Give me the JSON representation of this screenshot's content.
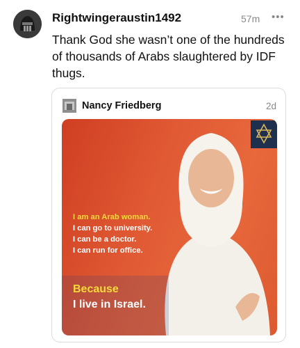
{
  "post": {
    "username": "Rightwingeraustin1492",
    "time": "57m",
    "more": "•••",
    "text": "Thank God she wasn’t one of the hundreds of thousands of Arabs slaughtered by IDF thugs."
  },
  "quote": {
    "name": "Nancy Friedberg",
    "time": "2d",
    "image": {
      "line1": "I am an Arab woman.",
      "line2": "I can go to university.",
      "line3": "I can be a doctor.",
      "line4": "I can run for office.",
      "because": "Because",
      "live": "I live in Israel."
    }
  },
  "colors": {
    "accent_orange": "#e05a34",
    "highlight_yellow": "#f3da3a"
  }
}
